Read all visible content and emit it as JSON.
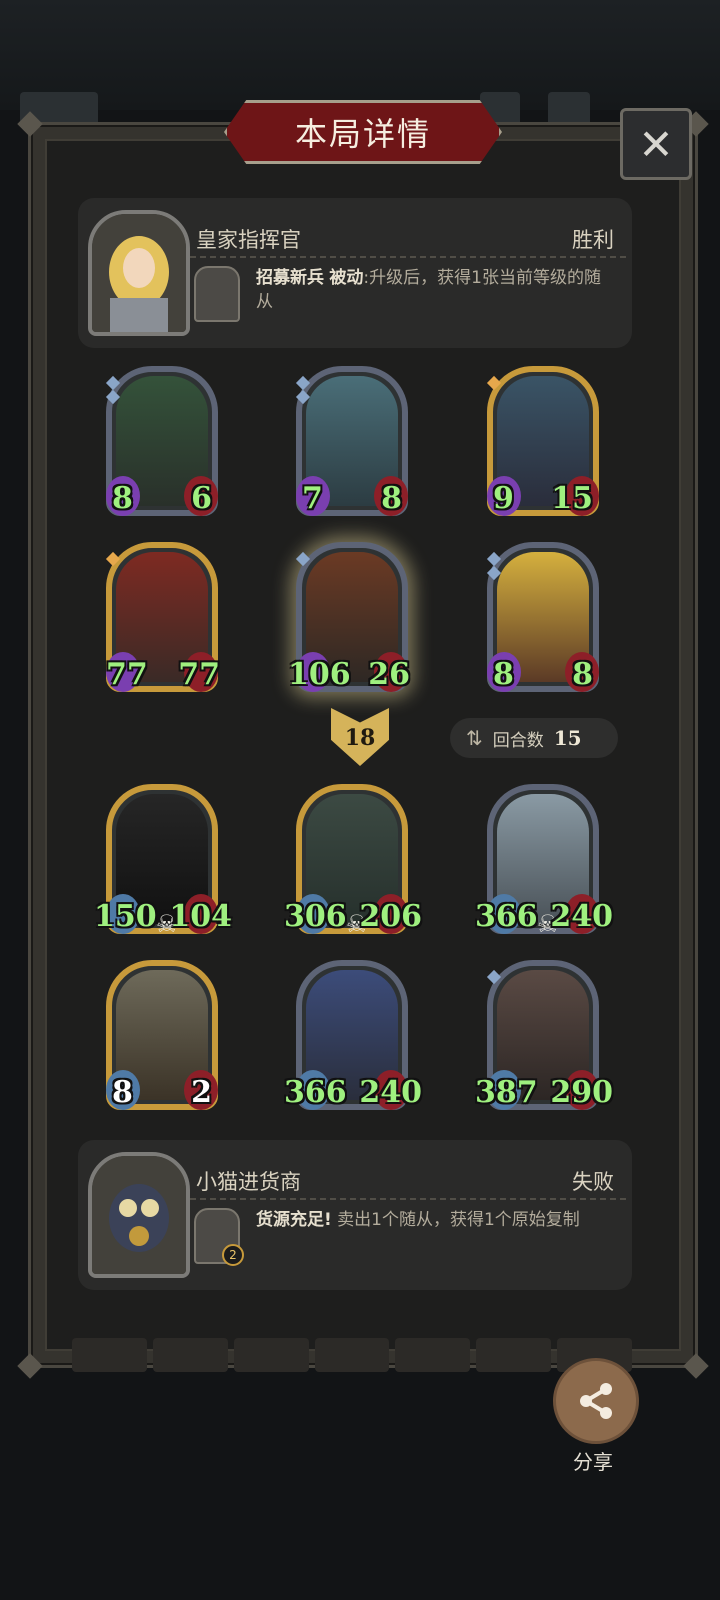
{
  "title": "本局详情",
  "close_glyph": "✕",
  "winner": {
    "name": "皇家指挥官",
    "result": "胜利",
    "skill_name": "招募新兵",
    "skill_type": "被动",
    "skill_desc": ":升级后，获得1张当前等级的随从"
  },
  "winner_cards": [
    {
      "atk": "8",
      "hp": "6"
    },
    {
      "atk": "7",
      "hp": "8"
    },
    {
      "atk": "9",
      "hp": "15"
    },
    {
      "atk": "77",
      "hp": "77"
    },
    {
      "atk": "106",
      "hp": "26"
    },
    {
      "atk": "8",
      "hp": "8"
    }
  ],
  "damage": "18",
  "round": {
    "label": "回合数",
    "value": "15"
  },
  "loser_cards": [
    {
      "atk": "150",
      "hp": "104"
    },
    {
      "atk": "306",
      "hp": "206"
    },
    {
      "atk": "366",
      "hp": "240"
    },
    {
      "atk": "8",
      "hp": "2"
    },
    {
      "atk": "366",
      "hp": "240"
    },
    {
      "atk": "387",
      "hp": "290"
    }
  ],
  "loser": {
    "name": "小猫进货商",
    "result": "失败",
    "skill_name": "货源充足!",
    "skill_desc": "卖出1个随从，获得1个原始复制",
    "skill_badge": "2"
  },
  "share_label": "分享",
  "colors": {
    "panel": "#1e1e1d",
    "banner": "#6e1517",
    "stat_green": "#9ff07f",
    "frame_gold": "#c79a3b",
    "frame_silver": "#5d6476"
  }
}
